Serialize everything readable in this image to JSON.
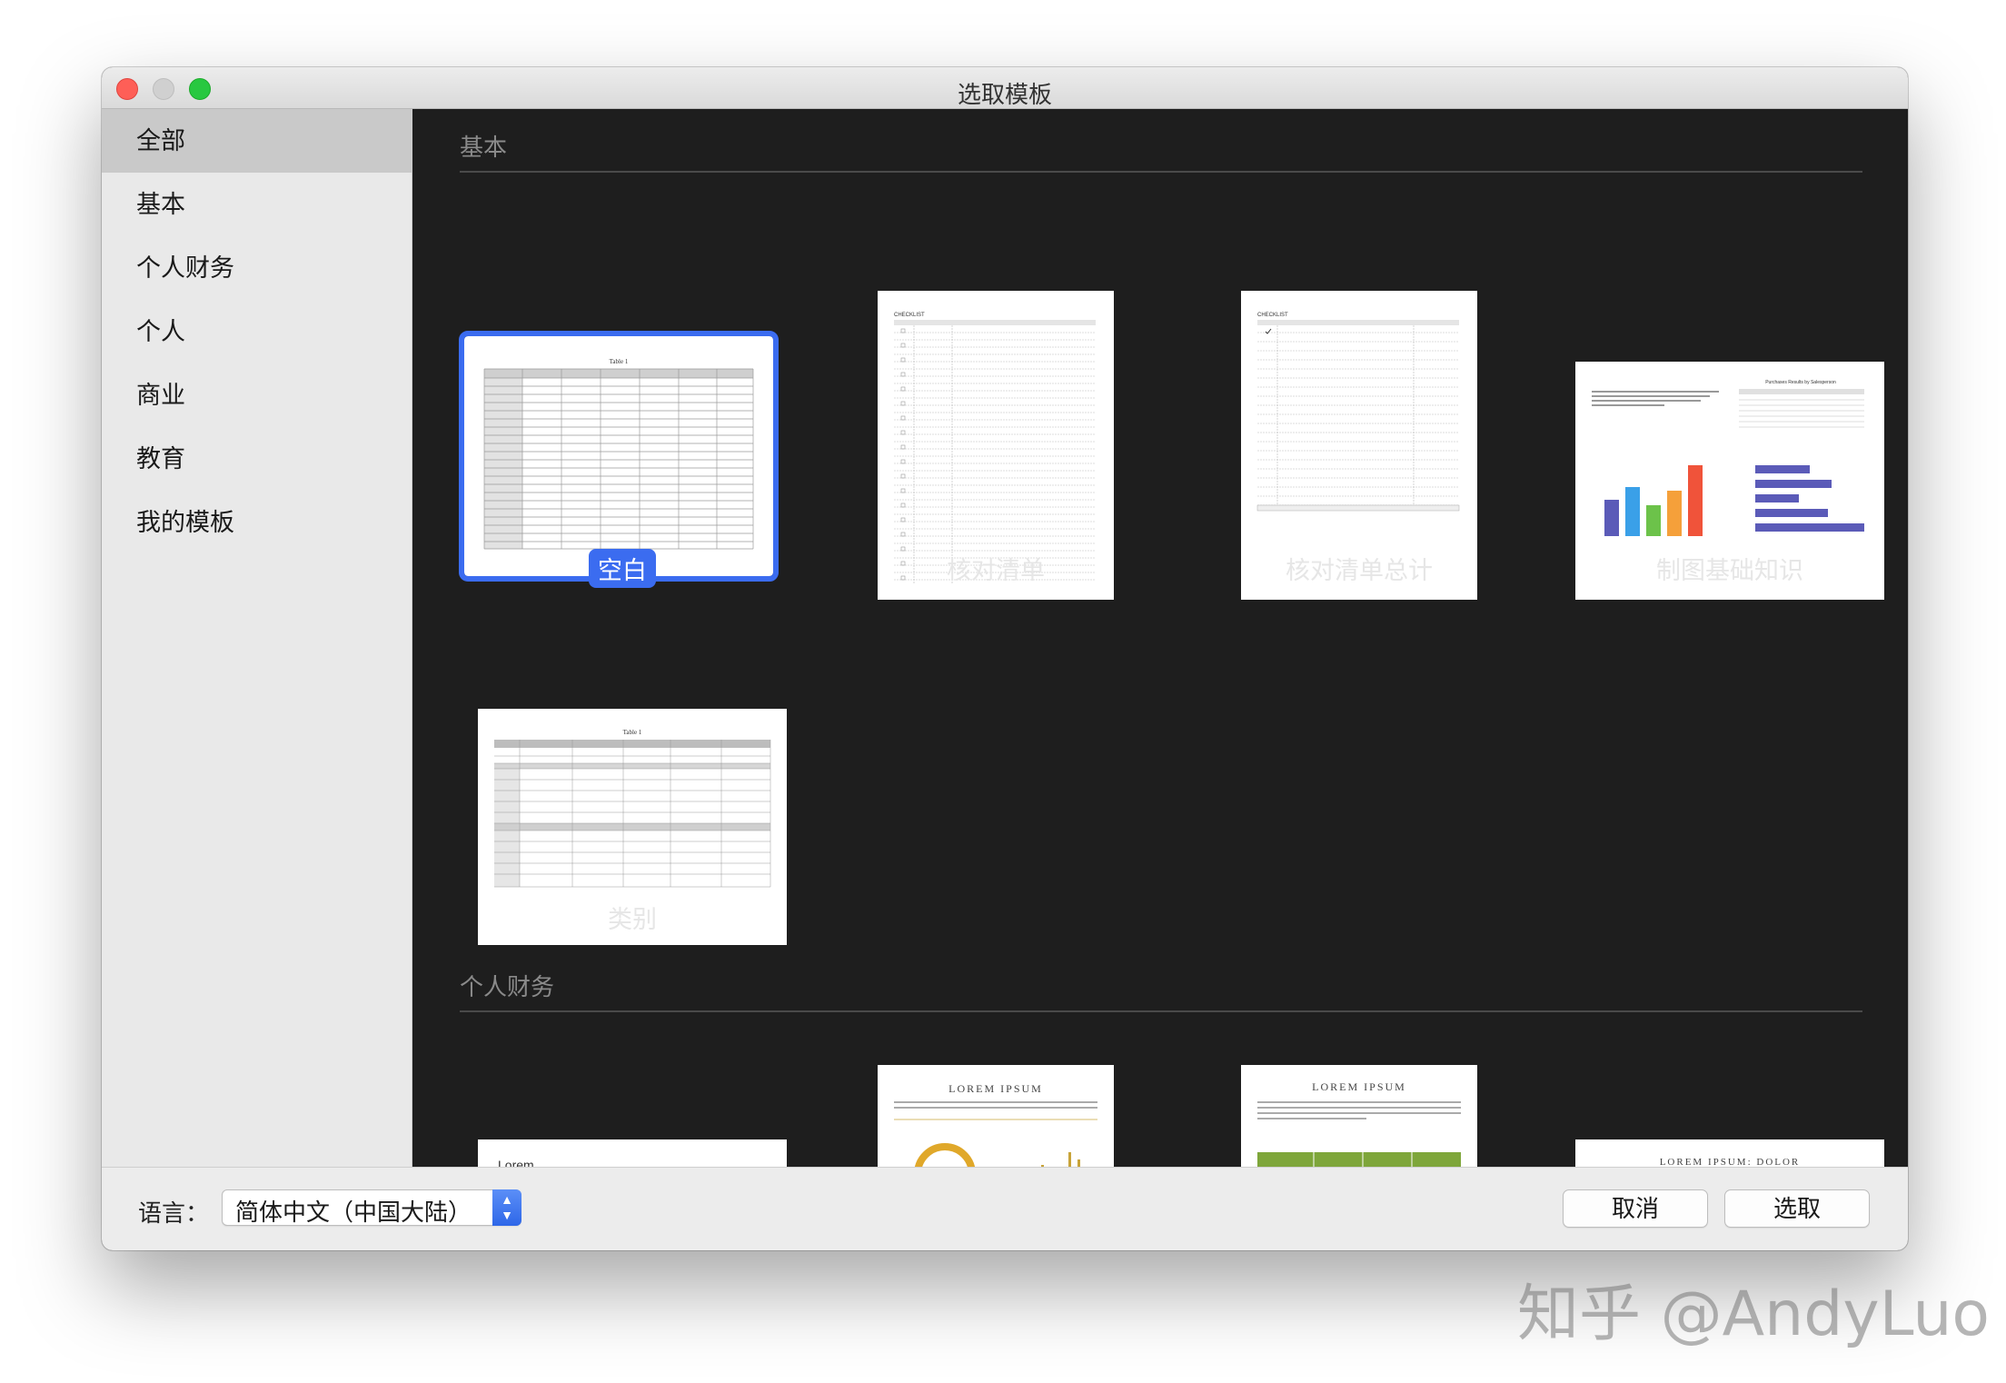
{
  "window": {
    "title": "选取模板"
  },
  "sidebar": {
    "items": [
      {
        "label": "全部",
        "active": true
      },
      {
        "label": "基本",
        "active": false
      },
      {
        "label": "个人财务",
        "active": false
      },
      {
        "label": "个人",
        "active": false
      },
      {
        "label": "商业",
        "active": false
      },
      {
        "label": "教育",
        "active": false
      },
      {
        "label": "我的模板",
        "active": false
      }
    ]
  },
  "sections": [
    {
      "title": "基本",
      "templates": [
        {
          "label": "空白",
          "selected": true,
          "thumb_text": "Table 1"
        },
        {
          "label": "核对清单",
          "selected": false,
          "thumb_text": "CHECKLIST"
        },
        {
          "label": "核对清单总计",
          "selected": false,
          "thumb_text": "CHECKLIST"
        },
        {
          "label": "制图基础知识",
          "selected": false,
          "thumb_text": "Purchases Results by Salesperson"
        },
        {
          "label": "类别",
          "selected": false,
          "thumb_text": "Table 1"
        }
      ]
    },
    {
      "title": "个人财务",
      "templates": [
        {
          "thumb_text": "Lorem"
        },
        {
          "thumb_text": "LOREM IPSUM"
        },
        {
          "thumb_text": "LOREM IPSUM"
        },
        {
          "thumb_text": "LOREM IPSUM: DOLOR"
        }
      ]
    }
  ],
  "footer": {
    "language_label": "语言：",
    "language_value": "简体中文（中国大陆）",
    "cancel_label": "取消",
    "choose_label": "选取"
  },
  "watermark": "知乎 @AndyLuo",
  "colors": {
    "accent": "#3b6cf0",
    "content_bg": "#1e1e1e",
    "sidebar_bg": "#e9e9e9"
  }
}
